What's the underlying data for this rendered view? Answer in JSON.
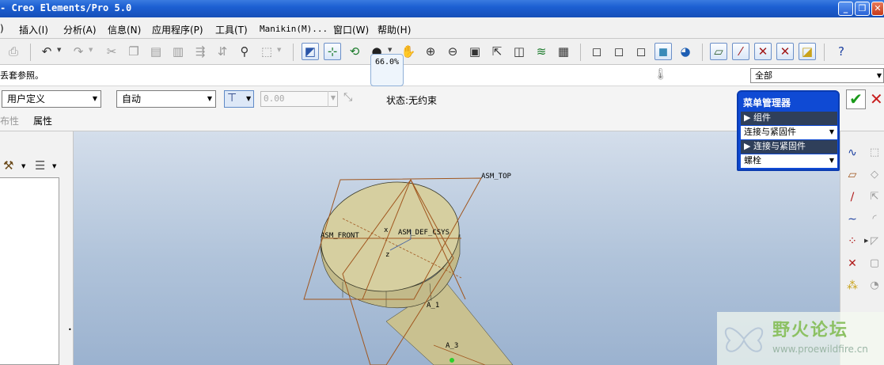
{
  "window": {
    "title": "- Creo Elements/Pro 5.0",
    "minimize": "_",
    "restore": "❐",
    "close": "✕"
  },
  "menubar": [
    {
      "key": "view",
      "label": ")"
    },
    {
      "key": "insert",
      "label": "插入(I)"
    },
    {
      "key": "analysis",
      "label": "分析(A)"
    },
    {
      "key": "info",
      "label": "信息(N)"
    },
    {
      "key": "applications",
      "label": "应用程序(P)"
    },
    {
      "key": "tools",
      "label": "工具(T)"
    },
    {
      "key": "manikin",
      "label": "Manikin(M)..."
    },
    {
      "key": "window",
      "label": "窗口(W)"
    },
    {
      "key": "help",
      "label": "帮助(H)"
    }
  ],
  "toolbar": {
    "zoom_tooltip": "66.0%"
  },
  "message": {
    "text": "丢套参照。",
    "filter_value": "全部"
  },
  "dashboard": {
    "constraint_type": "用户定义",
    "auto_value": "自动",
    "offset_value": "0.00",
    "status": "状态:无约束",
    "tab_placement": "布性",
    "tab_properties": "属性"
  },
  "menu_manager": {
    "title": "菜单管理器",
    "section1": "组件",
    "item1": "连接与紧固件",
    "section2": "连接与紧固件",
    "item2": "螺栓"
  },
  "datums": {
    "top": "ASM_TOP",
    "front": "ASM_FRONT",
    "csys": "ASM_DEF_CSYS",
    "axis1": "A_1",
    "axis3": "A_3",
    "csys_x": "x",
    "csys_z": "z"
  },
  "watermark": {
    "title": "野火论坛",
    "url": "www.proewildfire.cn"
  },
  "colors": {
    "titlebar": "#1c5fd2",
    "datum_plane": "#a0561e",
    "part_fill": "#d6cfa0",
    "menu_manager": "#0f4ad4",
    "ok_green": "#1a9a1a",
    "cancel_red": "#c81e1e"
  }
}
